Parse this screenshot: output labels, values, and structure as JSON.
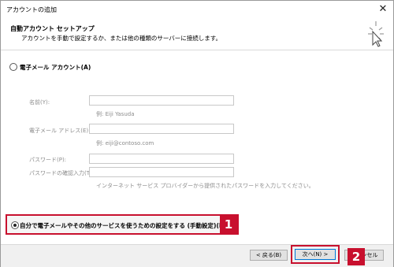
{
  "window": {
    "title": "アカウントの追加",
    "close_glyph": "✕"
  },
  "header": {
    "title": "自動アカウント セットアップ",
    "subtitle": "アカウントを手動で設定するか、または他の種類のサーバーに接続します。"
  },
  "email_account_option": {
    "label": "電子メール アカウント(A)",
    "selected": false
  },
  "fields": {
    "name": {
      "label": "名前(Y):",
      "value": "",
      "hint": "例: Eiji Yasuda"
    },
    "email": {
      "label": "電子メール アドレス(E):",
      "value": "",
      "hint": "例: eiji@contoso.com"
    },
    "password": {
      "label": "パスワード(P):",
      "value": ""
    },
    "password_confirm": {
      "label": "パスワードの確認入力(T):",
      "value": ""
    },
    "password_hint": "インターネット サービス プロバイダーから提供されたパスワードを入力してください。"
  },
  "manual_option": {
    "label": "自分で電子メールやその他のサービスを使うための設定をする (手動設定)(M)",
    "selected": true
  },
  "buttons": {
    "back": "< 戻る(B)",
    "next": "次へ(N) >",
    "cancel": "キャンセル"
  },
  "callouts": {
    "one": "1",
    "two": "2"
  },
  "colors": {
    "callout": "#c8102e",
    "button_face": "#e1e1e1",
    "default_button_border": "#0078d7"
  }
}
